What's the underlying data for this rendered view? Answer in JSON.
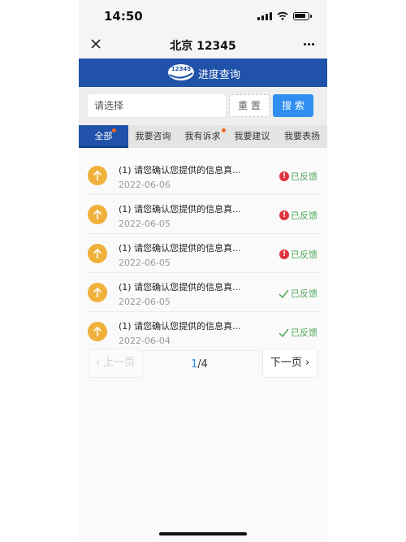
{
  "status_bar": {
    "time": "14:50"
  },
  "nav": {
    "title": "北京 12345"
  },
  "banner": {
    "logo_text": "12345",
    "title": "进度查询"
  },
  "search": {
    "placeholder": "请选择",
    "reset_label": "重 置",
    "search_label": "搜 索"
  },
  "tabs": [
    {
      "label": "全部",
      "active": true,
      "dot": true
    },
    {
      "label": "我要咨询",
      "active": false,
      "dot": false
    },
    {
      "label": "我有诉求",
      "active": false,
      "dot": true
    },
    {
      "label": "我要建议",
      "active": false,
      "dot": false
    },
    {
      "label": "我要表扬",
      "active": false,
      "dot": false
    }
  ],
  "items": [
    {
      "title": "(1) 请您确认您提供的信息真...",
      "date": "2022-06-06",
      "status": "已反馈",
      "status_icon": "error-icon"
    },
    {
      "title": "(1) 请您确认您提供的信息真...",
      "date": "2022-06-05",
      "status": "已反馈",
      "status_icon": "error-icon"
    },
    {
      "title": "(1) 请您确认您提供的信息真...",
      "date": "2022-06-05",
      "status": "已反馈",
      "status_icon": "error-icon"
    },
    {
      "title": "(1) 请您确认您提供的信息真...",
      "date": "2022-06-05",
      "status": "已反馈",
      "status_icon": "check-icon"
    },
    {
      "title": "(1) 请您确认您提供的信息真...",
      "date": "2022-06-04",
      "status": "已反馈",
      "status_icon": "check-icon"
    }
  ],
  "pagination": {
    "prev_label": "上一页",
    "next_label": "下一页",
    "current": "1",
    "separator": "/",
    "total": "4"
  },
  "colors": {
    "brand_blue": "#1f52a8",
    "accent_blue": "#2f8ef0",
    "success_green": "#4fa85a",
    "error_red": "#e0343b",
    "item_icon": "#f0b13a"
  }
}
